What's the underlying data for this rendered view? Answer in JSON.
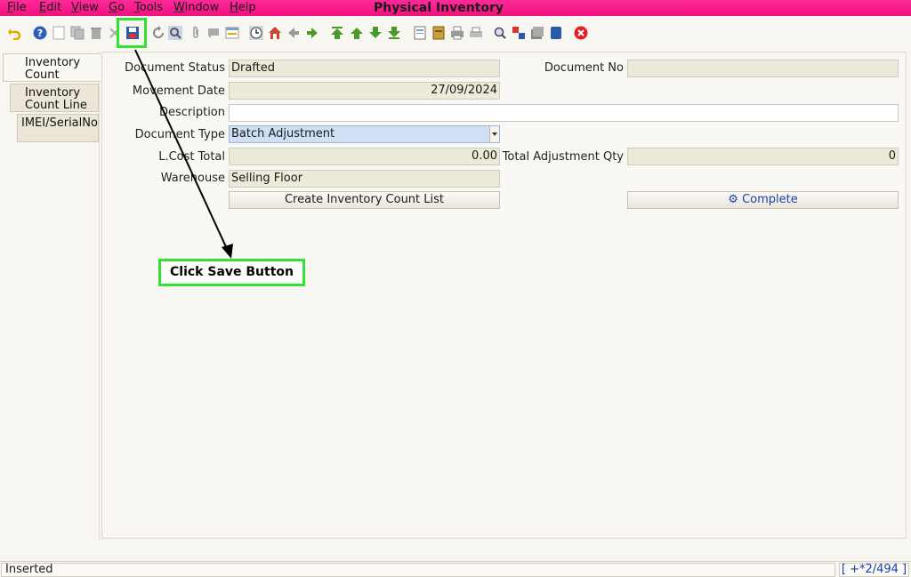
{
  "menu": {
    "items": [
      {
        "label": "File",
        "key": "F",
        "rest": "ile"
      },
      {
        "label": "Edit",
        "key": "E",
        "rest": "dit"
      },
      {
        "label": "View",
        "key": "V",
        "rest": "iew"
      },
      {
        "label": "Go",
        "key": "G",
        "rest": "o"
      },
      {
        "label": "Tools",
        "key": "T",
        "rest": "ools"
      },
      {
        "label": "Window",
        "key": "W",
        "rest": "indow"
      },
      {
        "label": "Help",
        "key": "H",
        "rest": "elp"
      }
    ],
    "title": "Physical Inventory",
    "bar_color": "#ff1493"
  },
  "toolbar": {
    "icons": [
      "undo-icon",
      "help-icon",
      "new-record-icon",
      "copy-record-icon",
      "delete-icon",
      "delete-selection-icon",
      "save-icon",
      "refresh-icon",
      "find-icon",
      "attachment-icon",
      "chat-icon",
      "grid-toggle-icon",
      "history-icon",
      "home-icon",
      "back-icon",
      "forward-icon",
      "first-record-icon",
      "previous-record-icon",
      "next-record-icon",
      "last-record-icon",
      "report-icon",
      "archive-icon",
      "print-icon",
      "print-preview-icon",
      "zoom-across-icon",
      "request-icon",
      "product-info-icon",
      "workflow-icon",
      "end-icon"
    ]
  },
  "tabs": [
    {
      "label_line1": "Inventory",
      "label_line2": "Count"
    },
    {
      "label_line1": "Inventory",
      "label_line2": "Count Line"
    },
    {
      "label_line1": "IMEI/SerialNo",
      "label_line2": ""
    }
  ],
  "form": {
    "document_status_label": "Document Status",
    "document_status_value": "Drafted",
    "document_no_label": "Document No",
    "document_no_value": "",
    "movement_date_label": "Movement Date",
    "movement_date_value": "27/09/2024",
    "description_label": "Description",
    "description_value": "",
    "document_type_label": "Document Type",
    "document_type_value": "Batch Adjustment",
    "lcost_total_label": "L.Cost Total",
    "lcost_total_value": "0.00",
    "total_adjustment_qty_label": "Total Adjustment Qty",
    "total_adjustment_qty_value": "0",
    "warehouse_label": "Warehouse",
    "warehouse_value": "Selling Floor",
    "create_list_button": "Create Inventory Count List",
    "complete_button": "Complete"
  },
  "annotation": {
    "callout_text": "Click Save Button",
    "highlight_color": "#33e233"
  },
  "status": {
    "message": "Inserted",
    "record_count": "[ +*2/494 ]"
  }
}
